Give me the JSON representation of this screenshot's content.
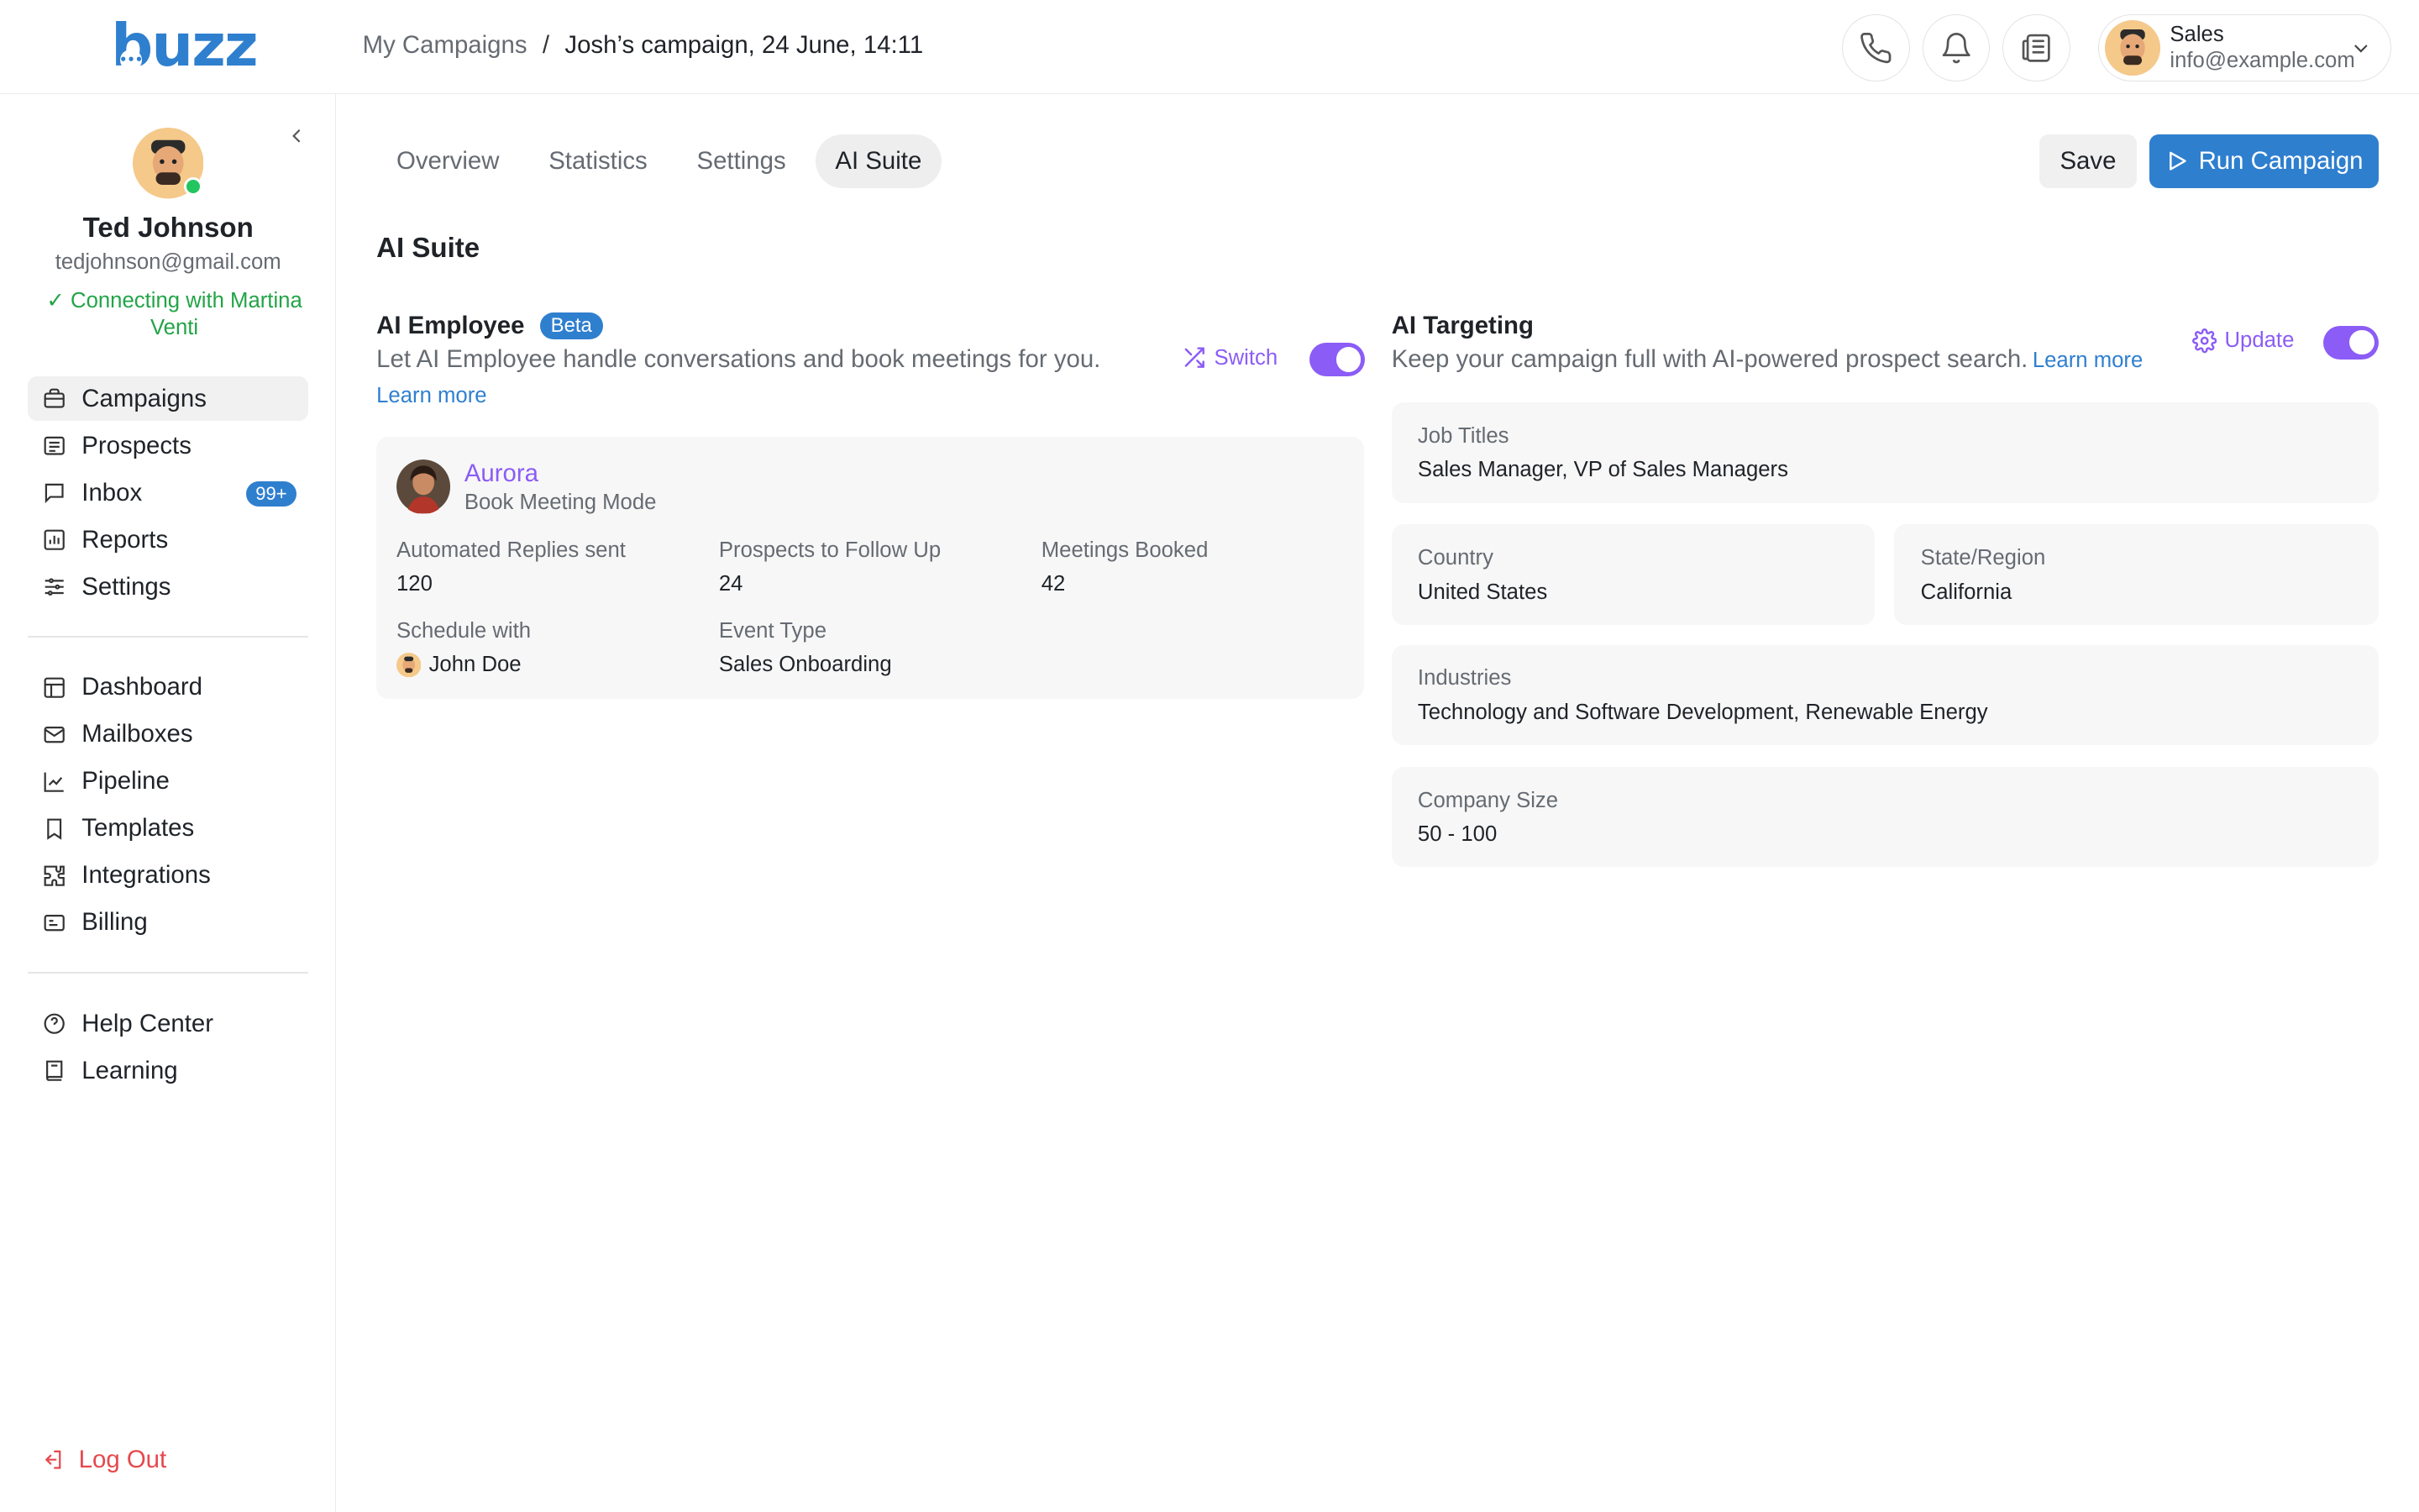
{
  "app": {
    "logo": "buzz"
  },
  "breadcrumb": {
    "parent": "My Campaigns",
    "separator": "/",
    "current": "Josh’s campaign, 24 June, 14:11"
  },
  "header": {
    "icons": [
      "phone-icon",
      "bell-icon",
      "newspaper-icon"
    ],
    "user": {
      "name": "Sales",
      "email": "info@example.com"
    }
  },
  "profile": {
    "name": "Ted Johnson",
    "email": "tedjohnson@gmail.com",
    "status": "Connecting with Martina Venti",
    "online": true
  },
  "sidebar": {
    "primary": [
      {
        "label": "Campaigns",
        "icon": "briefcase-icon",
        "active": true
      },
      {
        "label": "Prospects",
        "icon": "list-icon"
      },
      {
        "label": "Inbox",
        "icon": "message-icon",
        "badge": "99+"
      },
      {
        "label": "Reports",
        "icon": "chart-icon"
      },
      {
        "label": "Settings",
        "icon": "sliders-icon"
      }
    ],
    "secondary": [
      {
        "label": "Dashboard",
        "icon": "dashboard-icon"
      },
      {
        "label": "Mailboxes",
        "icon": "mail-icon"
      },
      {
        "label": "Pipeline",
        "icon": "trend-icon"
      },
      {
        "label": "Templates",
        "icon": "bookmark-icon"
      },
      {
        "label": "Integrations",
        "icon": "puzzle-icon"
      },
      {
        "label": "Billing",
        "icon": "card-icon"
      }
    ],
    "tertiary": [
      {
        "label": "Help Center",
        "icon": "help-icon"
      },
      {
        "label": "Learning",
        "icon": "book-icon"
      }
    ],
    "logout": "Log Out"
  },
  "tabs": [
    {
      "label": "Overview"
    },
    {
      "label": "Statistics"
    },
    {
      "label": "Settings"
    },
    {
      "label": "AI Suite",
      "active": true
    }
  ],
  "actions": {
    "save": "Save",
    "run": "Run Campaign"
  },
  "page": {
    "title": "AI Suite"
  },
  "ai_employee": {
    "title": "AI Employee",
    "badge": "Beta",
    "description": "Let AI Employee handle conversations and book meetings for you.",
    "learn_more": "Learn more",
    "switch_label": "Switch",
    "enabled": true,
    "agent": {
      "name": "Aurora",
      "mode": "Book Meeting Mode"
    },
    "stats": {
      "replies_label": "Automated Replies sent",
      "replies_value": "120",
      "followup_label": "Prospects to Follow Up",
      "followup_value": "24",
      "meetings_label": "Meetings Booked",
      "meetings_value": "42",
      "schedule_label": "Schedule with",
      "schedule_value": "John Doe",
      "event_label": "Event Type",
      "event_value": "Sales Onboarding"
    }
  },
  "ai_targeting": {
    "title": "AI Targeting",
    "description": "Keep your campaign full with AI-powered prospect search.",
    "learn_more": "Learn more",
    "update_label": "Update",
    "enabled": true,
    "fields": {
      "job_titles": {
        "label": "Job Titles",
        "value": "Sales Manager, VP of Sales Managers"
      },
      "country": {
        "label": "Country",
        "value": "United States"
      },
      "state": {
        "label": "State/Region",
        "value": "California"
      },
      "industries": {
        "label": "Industries",
        "value": "Technology and Software Development, Renewable Energy"
      },
      "company_size": {
        "label": "Company Size",
        "value": "50 - 100"
      }
    }
  },
  "colors": {
    "brand": "#2f7fcf",
    "accent": "#8b5cf6",
    "success": "#22a447",
    "danger": "#e5484d"
  }
}
